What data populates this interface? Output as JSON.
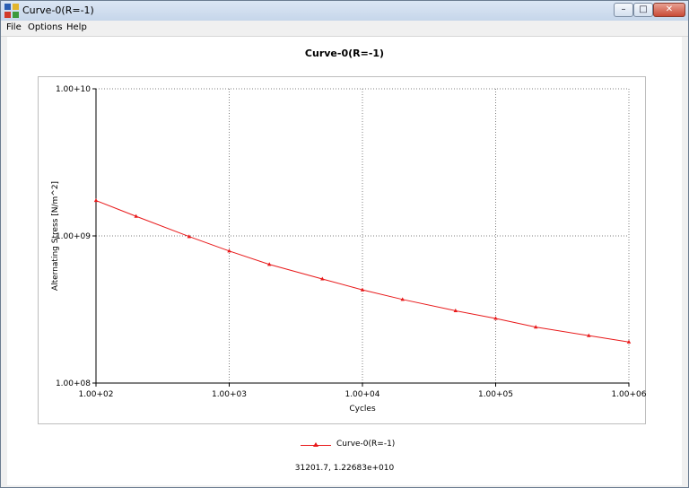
{
  "window": {
    "title": "Curve-0(R=-1)",
    "controls": {
      "minimize": "–",
      "maximize": "□",
      "close": "✕"
    }
  },
  "menu": {
    "items": [
      "File",
      "Options",
      "Help"
    ]
  },
  "chart_data": {
    "type": "line",
    "title": "Curve-0(R=-1)",
    "xlabel": "Cycles",
    "ylabel": "Alternating Stress [N/m^2]",
    "x_scale": "log",
    "y_scale": "log",
    "xlim": [
      100,
      1000000
    ],
    "ylim": [
      100000000,
      10000000000
    ],
    "x_ticks": [
      "1.00+02",
      "1.00+03",
      "1.00+04",
      "1.00+05",
      "1.00+06"
    ],
    "y_ticks": [
      "1.00+08",
      "1.00+09",
      "1.00+10"
    ],
    "grid": true,
    "legend_position": "bottom",
    "series": [
      {
        "name": "Curve-0(R=-1)",
        "color": "#e8191a",
        "marker": "triangle",
        "x": [
          100,
          200,
          500,
          1000,
          2000,
          5000,
          10000,
          20000,
          50000,
          100000,
          200000,
          500000,
          1000000
        ],
        "y": [
          1740000000,
          1360000000,
          990000000,
          790000000,
          640000000,
          510000000,
          430000000,
          370000000,
          310000000,
          275000000,
          240000000,
          210000000,
          190000000
        ]
      }
    ]
  },
  "status": {
    "coordinates": "31201.7, 1.22683e+010"
  },
  "colors": {
    "series": "#e8191a",
    "grid": "#808080",
    "axis": "#000000"
  }
}
